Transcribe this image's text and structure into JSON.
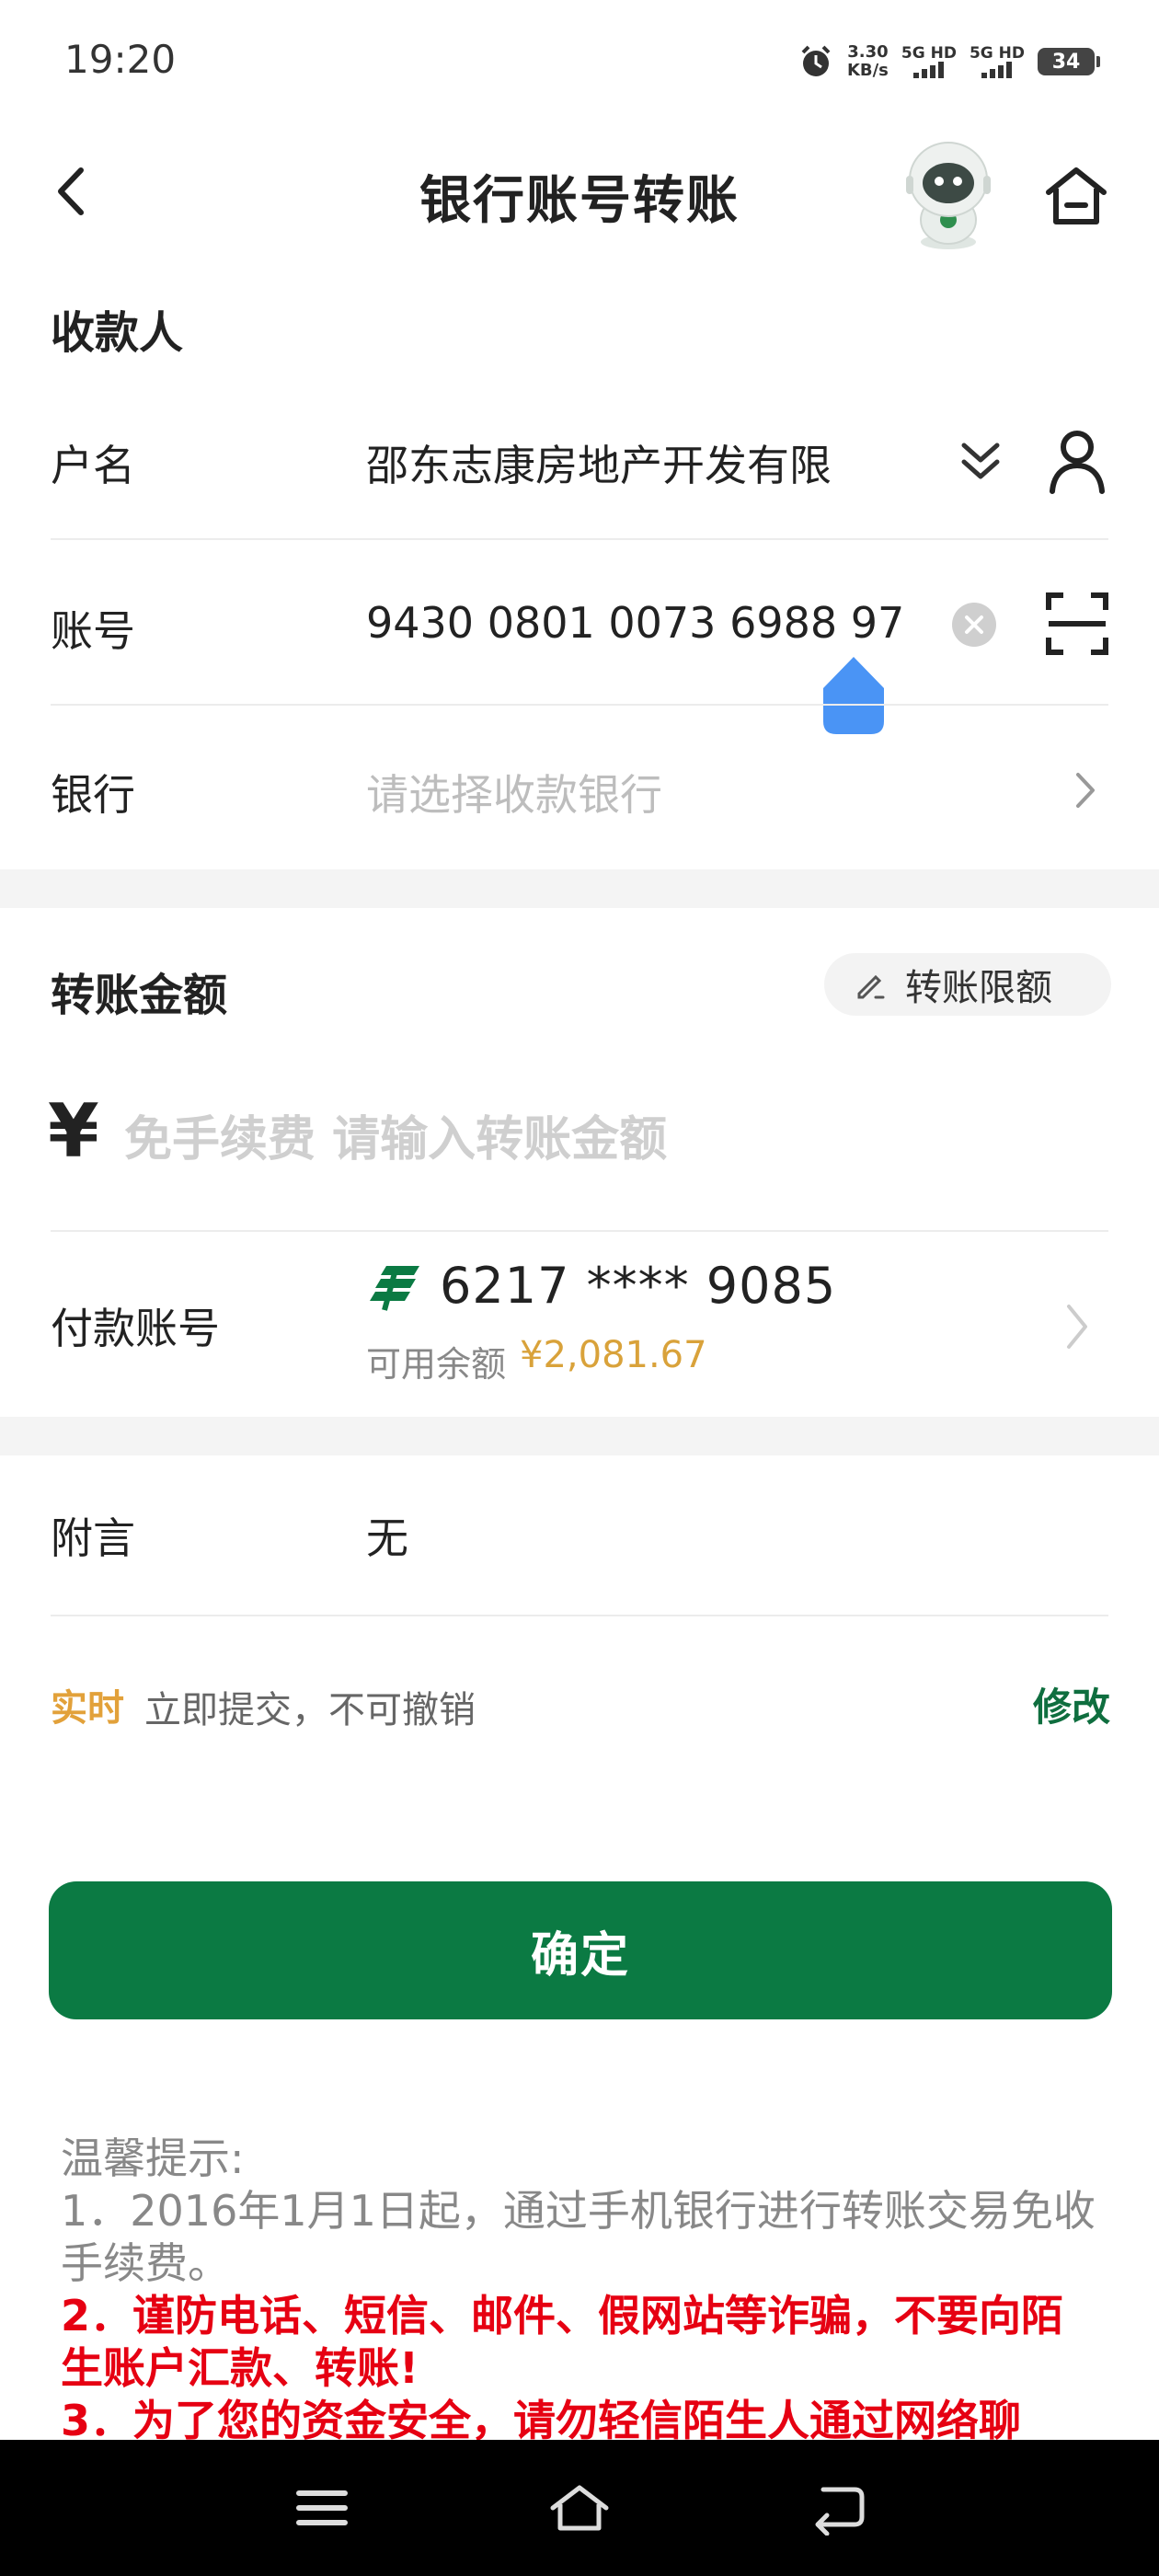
{
  "status_bar": {
    "time": "19:20",
    "net_speed_value": "3.30",
    "net_speed_unit": "KB/s",
    "sim1_label": "5G HD",
    "sim2_label": "5G HD",
    "battery": "34"
  },
  "header": {
    "title": "银行账号转账"
  },
  "payee": {
    "section_title": "收款人",
    "name_label": "户名",
    "name_value": "邵东志康房地产开发有限",
    "account_label": "账号",
    "account_value": "9430 0801 0073 6988 97",
    "bank_label": "银行",
    "bank_placeholder": "请选择收款银行"
  },
  "amount": {
    "section_title": "转账金额",
    "limit_button": "转账限额",
    "currency_symbol": "¥",
    "placeholder": "免手续费 请输入转账金额"
  },
  "payer": {
    "label": "付款账号",
    "card_number": "6217 **** 9085",
    "available_label": "可用余额",
    "available_amount": "¥2,081.67"
  },
  "remark": {
    "label": "附言",
    "value": "无"
  },
  "timing": {
    "tag": "实时",
    "description": "立即提交，不可撤销",
    "modify": "修改"
  },
  "confirm_button": "确定",
  "tips": {
    "title": "温馨提示:",
    "line1": "1．2016年1月1日起，通过手机银行进行转账交易免收手续费。",
    "line2": "2．谨防电话、短信、邮件、假网站等诈骗，不要向陌生账户汇款、转账!",
    "line3": "3．为了您的资金安全，请勿轻信陌生人通过网络聊"
  },
  "colors": {
    "brand_green": "#0b7a43",
    "amount_gold": "#d9a23a",
    "warning_red": "#e60012",
    "tag_orange": "#e2a13a"
  }
}
